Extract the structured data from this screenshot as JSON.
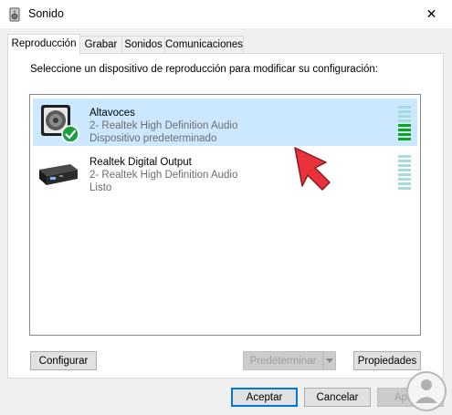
{
  "window": {
    "title": "Sonido",
    "close_glyph": "✕"
  },
  "tabs": [
    {
      "label": "Reproducción",
      "active": true
    },
    {
      "label": "Grabar",
      "active": false
    },
    {
      "label": "Sonidos",
      "active": false
    },
    {
      "label": "Comunicaciones",
      "active": false
    }
  ],
  "instruction": "Seleccione un dispositivo de reproducción para modificar su configuración:",
  "devices": [
    {
      "name": "Altavoces",
      "line1": "2- Realtek High Definition Audio",
      "line2": "Dispositivo predeterminado",
      "selected": true,
      "default": true,
      "icon": "speaker-icon"
    },
    {
      "name": "Realtek Digital Output",
      "line1": "2- Realtek High Definition Audio",
      "line2": "Listo",
      "selected": false,
      "default": false,
      "icon": "digital-output-icon"
    }
  ],
  "buttons": {
    "configure": "Configurar",
    "set_default": "Predeterminar",
    "properties": "Propiedades",
    "accept": "Aceptar",
    "cancel": "Cancelar",
    "apply": "Aplicar"
  },
  "colors": {
    "selection": "#cce8ff",
    "level_active": "#0ea41d",
    "level_idle": "#a8dcdc",
    "arrow": "#e8323c"
  }
}
